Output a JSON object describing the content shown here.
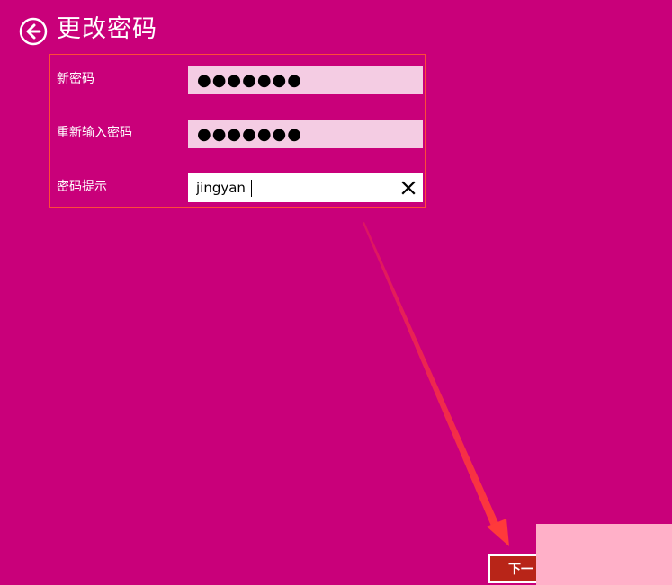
{
  "header": {
    "title": "更改密码",
    "back_icon": "back-arrow-circle-icon"
  },
  "form": {
    "new_password_label": "新密码",
    "new_password_value": "●●●●●●●",
    "confirm_password_label": "重新输入密码",
    "confirm_password_value": "●●●●●●●",
    "hint_label": "密码提示",
    "hint_value": "jingyan",
    "clear_icon": "close-icon"
  },
  "footer": {
    "next_label": "下一"
  },
  "colors": {
    "background": "#c9007a",
    "password_field": "#f4cce3",
    "annotation": "#ff4a38",
    "next_button": "#b82518"
  }
}
